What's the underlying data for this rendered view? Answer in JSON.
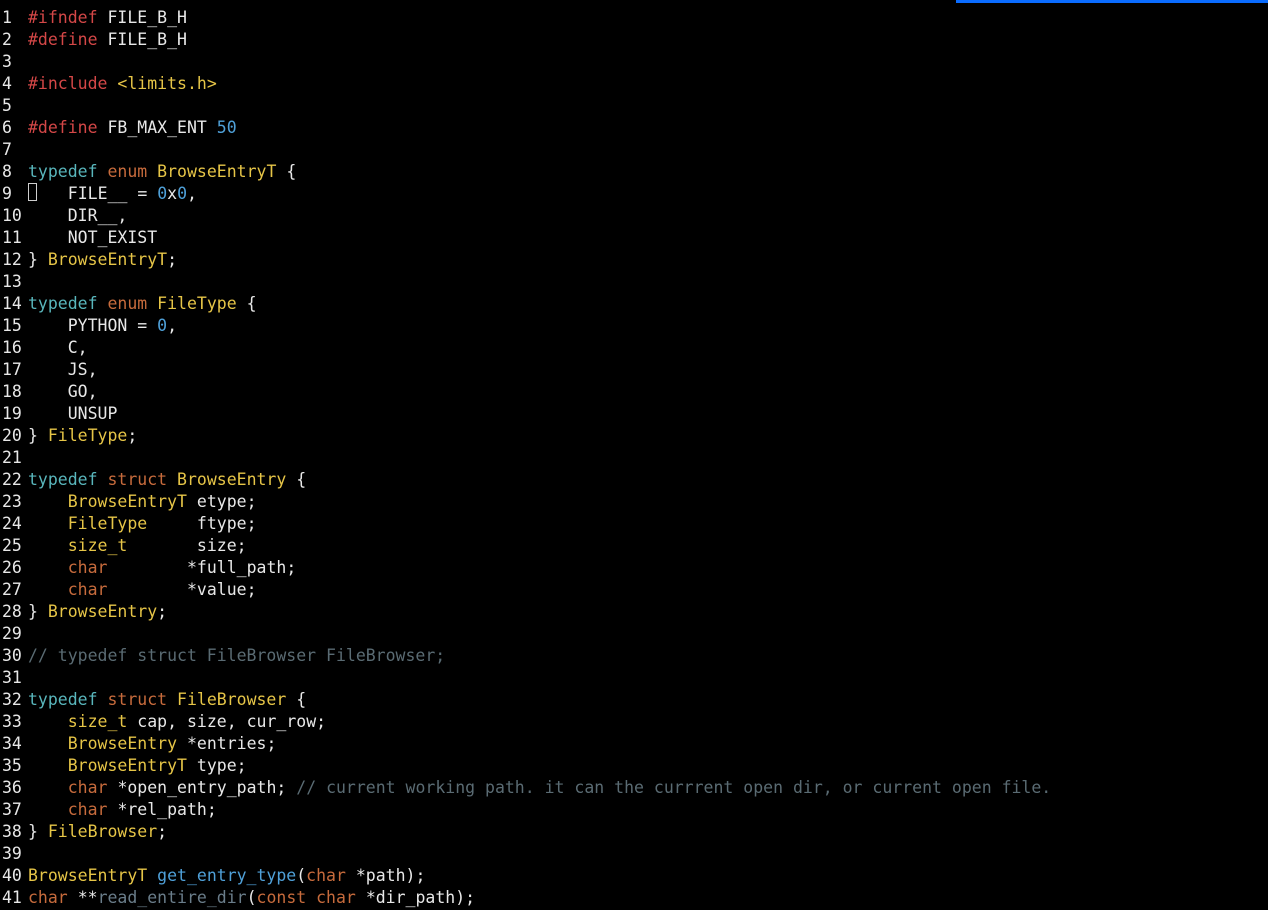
{
  "lines": [
    {
      "n": "1",
      "tokens": [
        [
          "t-pp",
          "#ifndef"
        ],
        [
          "t-id",
          " "
        ],
        [
          "t-mac",
          "FILE_B_H"
        ]
      ]
    },
    {
      "n": "2",
      "tokens": [
        [
          "t-pp",
          "#define"
        ],
        [
          "t-id",
          " "
        ],
        [
          "t-mac",
          "FILE_B_H"
        ]
      ]
    },
    {
      "n": "3",
      "tokens": []
    },
    {
      "n": "4",
      "tokens": [
        [
          "t-pp",
          "#include"
        ],
        [
          "t-id",
          " "
        ],
        [
          "t-inc",
          "<limits.h>"
        ]
      ]
    },
    {
      "n": "5",
      "tokens": []
    },
    {
      "n": "6",
      "tokens": [
        [
          "t-pp",
          "#define"
        ],
        [
          "t-id",
          " "
        ],
        [
          "t-mac",
          "FB_MAX_ENT "
        ],
        [
          "t-num",
          "50"
        ]
      ]
    },
    {
      "n": "7",
      "tokens": []
    },
    {
      "n": "8",
      "tokens": [
        [
          "t-kw",
          "typedef"
        ],
        [
          "t-id",
          " "
        ],
        [
          "t-kw2",
          "enum"
        ],
        [
          "t-id",
          " "
        ],
        [
          "t-type",
          "BrowseEntryT"
        ],
        [
          "t-id",
          " "
        ],
        [
          "t-punc",
          "{"
        ]
      ]
    },
    {
      "n": "9",
      "cursor": true,
      "tokens": [
        [
          "t-id",
          "   FILE__ "
        ],
        [
          "t-punc",
          "="
        ],
        [
          "t-id",
          " "
        ],
        [
          "t-num",
          "0"
        ],
        [
          "t-id",
          "x"
        ],
        [
          "t-num",
          "0"
        ],
        [
          "t-punc",
          ","
        ]
      ]
    },
    {
      "n": "10",
      "tokens": [
        [
          "t-id",
          "    DIR__"
        ],
        [
          "t-punc",
          ","
        ]
      ]
    },
    {
      "n": "11",
      "tokens": [
        [
          "t-id",
          "    NOT_EXIST"
        ]
      ]
    },
    {
      "n": "12",
      "tokens": [
        [
          "t-punc",
          "}"
        ],
        [
          "t-id",
          " "
        ],
        [
          "t-type",
          "BrowseEntryT"
        ],
        [
          "t-punc",
          ";"
        ]
      ]
    },
    {
      "n": "13",
      "tokens": []
    },
    {
      "n": "14",
      "tokens": [
        [
          "t-kw",
          "typedef"
        ],
        [
          "t-id",
          " "
        ],
        [
          "t-kw2",
          "enum"
        ],
        [
          "t-id",
          " "
        ],
        [
          "t-type",
          "FileType"
        ],
        [
          "t-id",
          " "
        ],
        [
          "t-punc",
          "{"
        ]
      ]
    },
    {
      "n": "15",
      "tokens": [
        [
          "t-id",
          "    PYTHON "
        ],
        [
          "t-punc",
          "="
        ],
        [
          "t-id",
          " "
        ],
        [
          "t-num",
          "0"
        ],
        [
          "t-punc",
          ","
        ]
      ]
    },
    {
      "n": "16",
      "tokens": [
        [
          "t-id",
          "    C"
        ],
        [
          "t-punc",
          ","
        ]
      ]
    },
    {
      "n": "17",
      "tokens": [
        [
          "t-id",
          "    JS"
        ],
        [
          "t-punc",
          ","
        ]
      ]
    },
    {
      "n": "18",
      "tokens": [
        [
          "t-id",
          "    GO"
        ],
        [
          "t-punc",
          ","
        ]
      ]
    },
    {
      "n": "19",
      "tokens": [
        [
          "t-id",
          "    UNSUP"
        ]
      ]
    },
    {
      "n": "20",
      "tokens": [
        [
          "t-punc",
          "}"
        ],
        [
          "t-id",
          " "
        ],
        [
          "t-type",
          "FileType"
        ],
        [
          "t-punc",
          ";"
        ]
      ]
    },
    {
      "n": "21",
      "tokens": []
    },
    {
      "n": "22",
      "tokens": [
        [
          "t-kw",
          "typedef"
        ],
        [
          "t-id",
          " "
        ],
        [
          "t-kw2",
          "struct"
        ],
        [
          "t-id",
          " "
        ],
        [
          "t-type",
          "BrowseEntry"
        ],
        [
          "t-id",
          " "
        ],
        [
          "t-punc",
          "{"
        ]
      ]
    },
    {
      "n": "23",
      "tokens": [
        [
          "t-id",
          "    "
        ],
        [
          "t-type",
          "BrowseEntryT"
        ],
        [
          "t-id",
          " etype"
        ],
        [
          "t-punc",
          ";"
        ]
      ]
    },
    {
      "n": "24",
      "tokens": [
        [
          "t-id",
          "    "
        ],
        [
          "t-type",
          "FileType"
        ],
        [
          "t-id",
          "     ftype"
        ],
        [
          "t-punc",
          ";"
        ]
      ]
    },
    {
      "n": "25",
      "tokens": [
        [
          "t-id",
          "    "
        ],
        [
          "t-type",
          "size_t"
        ],
        [
          "t-id",
          "       size"
        ],
        [
          "t-punc",
          ";"
        ]
      ]
    },
    {
      "n": "26",
      "tokens": [
        [
          "t-id",
          "    "
        ],
        [
          "t-kw2",
          "char"
        ],
        [
          "t-id",
          "        "
        ],
        [
          "t-punc",
          "*"
        ],
        [
          "t-id",
          "full_path"
        ],
        [
          "t-punc",
          ";"
        ]
      ]
    },
    {
      "n": "27",
      "tokens": [
        [
          "t-id",
          "    "
        ],
        [
          "t-kw2",
          "char"
        ],
        [
          "t-id",
          "        "
        ],
        [
          "t-punc",
          "*"
        ],
        [
          "t-id",
          "value"
        ],
        [
          "t-punc",
          ";"
        ]
      ]
    },
    {
      "n": "28",
      "tokens": [
        [
          "t-punc",
          "}"
        ],
        [
          "t-id",
          " "
        ],
        [
          "t-type",
          "BrowseEntry"
        ],
        [
          "t-punc",
          ";"
        ]
      ]
    },
    {
      "n": "29",
      "tokens": []
    },
    {
      "n": "30",
      "tokens": [
        [
          "t-cmt",
          "// typedef struct FileBrowser FileBrowser;"
        ]
      ]
    },
    {
      "n": "31",
      "tokens": []
    },
    {
      "n": "32",
      "tokens": [
        [
          "t-kw",
          "typedef"
        ],
        [
          "t-id",
          " "
        ],
        [
          "t-kw2",
          "struct"
        ],
        [
          "t-id",
          " "
        ],
        [
          "t-type",
          "FileBrowser"
        ],
        [
          "t-id",
          " "
        ],
        [
          "t-punc",
          "{"
        ]
      ]
    },
    {
      "n": "33",
      "tokens": [
        [
          "t-id",
          "    "
        ],
        [
          "t-type",
          "size_t"
        ],
        [
          "t-id",
          " cap"
        ],
        [
          "t-punc",
          ","
        ],
        [
          "t-id",
          " size"
        ],
        [
          "t-punc",
          ","
        ],
        [
          "t-id",
          " cur_row"
        ],
        [
          "t-punc",
          ";"
        ]
      ]
    },
    {
      "n": "34",
      "tokens": [
        [
          "t-id",
          "    "
        ],
        [
          "t-type",
          "BrowseEntry"
        ],
        [
          "t-id",
          " "
        ],
        [
          "t-punc",
          "*"
        ],
        [
          "t-id",
          "entries"
        ],
        [
          "t-punc",
          ";"
        ]
      ]
    },
    {
      "n": "35",
      "tokens": [
        [
          "t-id",
          "    "
        ],
        [
          "t-type",
          "BrowseEntryT"
        ],
        [
          "t-id",
          " type"
        ],
        [
          "t-punc",
          ";"
        ]
      ]
    },
    {
      "n": "36",
      "tokens": [
        [
          "t-id",
          "    "
        ],
        [
          "t-kw2",
          "char"
        ],
        [
          "t-id",
          " "
        ],
        [
          "t-punc",
          "*"
        ],
        [
          "t-id",
          "open_entry_path"
        ],
        [
          "t-punc",
          ";"
        ],
        [
          "t-id",
          " "
        ],
        [
          "t-cmt",
          "// current working path. it can the currrent open dir, or current open file."
        ]
      ]
    },
    {
      "n": "37",
      "tokens": [
        [
          "t-id",
          "    "
        ],
        [
          "t-kw2",
          "char"
        ],
        [
          "t-id",
          " "
        ],
        [
          "t-punc",
          "*"
        ],
        [
          "t-id",
          "rel_path"
        ],
        [
          "t-punc",
          ";"
        ]
      ]
    },
    {
      "n": "38",
      "tokens": [
        [
          "t-punc",
          "}"
        ],
        [
          "t-id",
          " "
        ],
        [
          "t-type",
          "FileBrowser"
        ],
        [
          "t-punc",
          ";"
        ]
      ]
    },
    {
      "n": "39",
      "tokens": []
    },
    {
      "n": "40",
      "tokens": [
        [
          "t-type",
          "BrowseEntryT"
        ],
        [
          "t-id",
          " "
        ],
        [
          "t-func",
          "get_entry_type"
        ],
        [
          "t-punc",
          "("
        ],
        [
          "t-kw2",
          "char"
        ],
        [
          "t-id",
          " "
        ],
        [
          "t-punc",
          "*"
        ],
        [
          "t-id",
          "path"
        ],
        [
          "t-punc",
          ");"
        ]
      ]
    },
    {
      "n": "41",
      "tokens": [
        [
          "t-kw2",
          "char"
        ],
        [
          "t-id",
          " "
        ],
        [
          "t-punc",
          "**"
        ],
        [
          "t-dimfn",
          "read_entire_dir"
        ],
        [
          "t-punc",
          "("
        ],
        [
          "t-kw2",
          "const"
        ],
        [
          "t-id",
          " "
        ],
        [
          "t-kw2",
          "char"
        ],
        [
          "t-id",
          " "
        ],
        [
          "t-punc",
          "*"
        ],
        [
          "t-id",
          "dir_path"
        ],
        [
          "t-punc",
          ");"
        ]
      ]
    }
  ]
}
